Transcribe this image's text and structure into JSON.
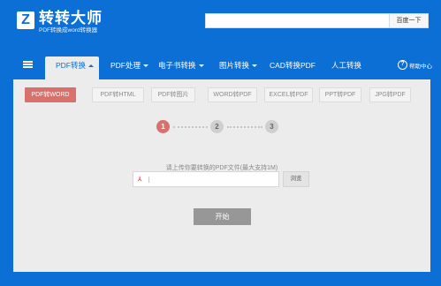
{
  "brand": {
    "logo_letter": "Z",
    "title": "转转大师",
    "subtitle": "PDF转换成word转换器"
  },
  "search": {
    "value": "",
    "placeholder": "",
    "button_label": "百度一下"
  },
  "nav": {
    "items": [
      {
        "label": "PDF转换",
        "active": true
      },
      {
        "label": "PDF处理"
      },
      {
        "label": "电子书转换"
      },
      {
        "label": "图片转换"
      },
      {
        "label": "CAD转换PDF"
      },
      {
        "label": "人工转换"
      }
    ],
    "help_label": "帮助中心",
    "help_glyph": "?"
  },
  "tabs": [
    {
      "label": "PDF转WORD",
      "active": true
    },
    {
      "label": "PDF转HTML"
    },
    {
      "label": "PDF转图片"
    },
    {
      "label": "WORD转PDF"
    },
    {
      "label": "EXCEL转PDF"
    },
    {
      "label": "PPT转PDF"
    },
    {
      "label": "JPG转PDF"
    }
  ],
  "steps": [
    "1",
    "2",
    "3"
  ],
  "current_step": 1,
  "upload": {
    "hint": "请上传你要转换的PDF文件(最大支持1M)",
    "file_value": "",
    "browse_label": "浏览",
    "pdf_icon_glyph": "⅄"
  },
  "start_label": "开始",
  "colors": {
    "brand_blue": "#0b6fd6",
    "accent_red": "#d9706c",
    "panel_bg": "#ececec",
    "button_gray": "#979797"
  }
}
